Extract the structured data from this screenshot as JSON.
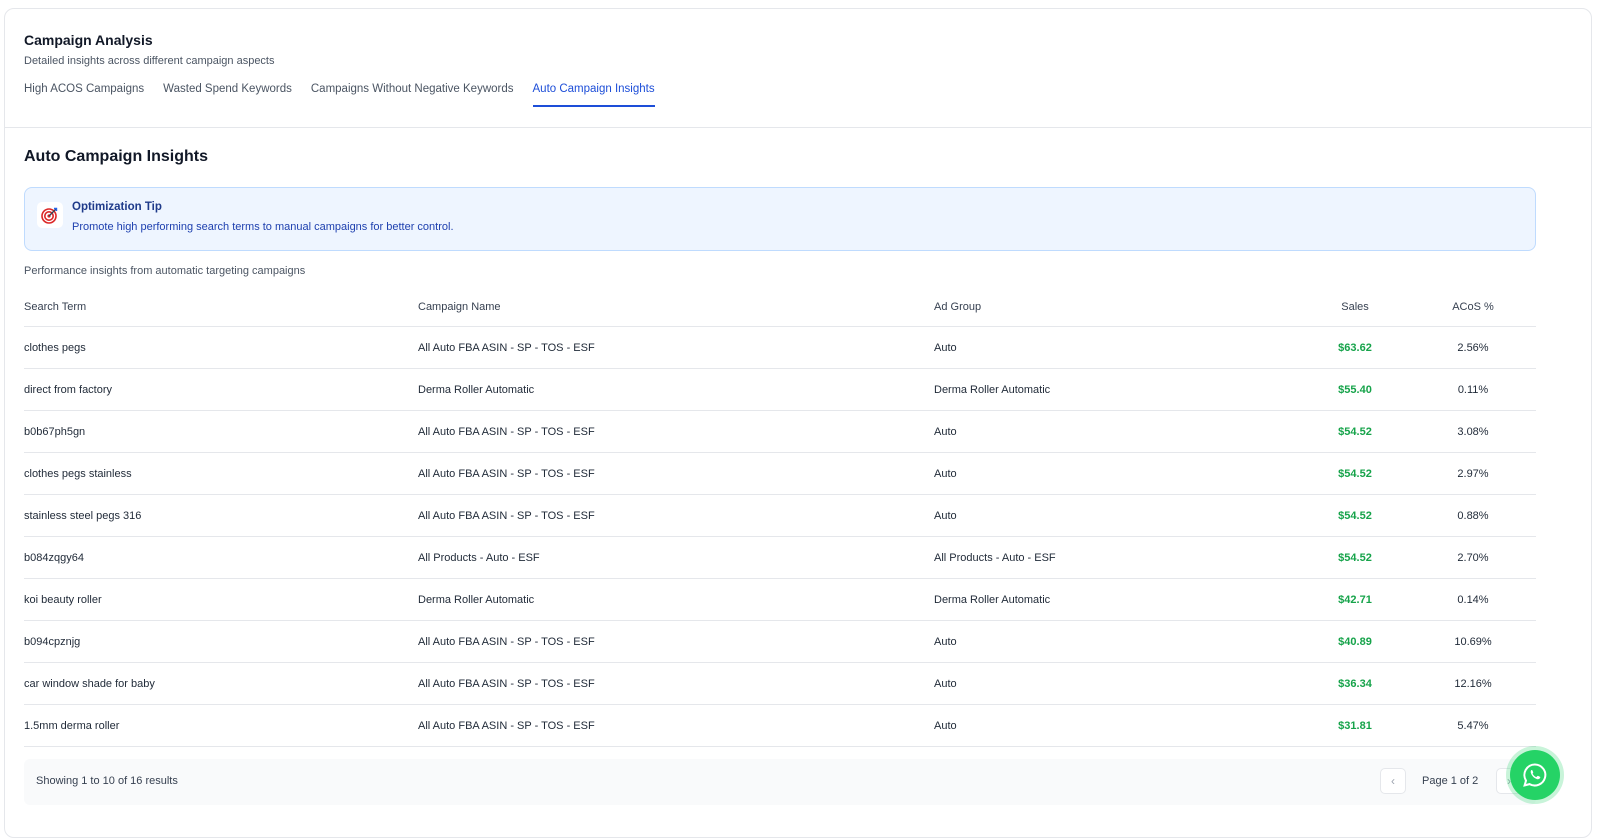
{
  "header": {
    "title": "Campaign Analysis",
    "subtitle": "Detailed insights across different campaign aspects",
    "tabs": [
      {
        "label": "High ACOS Campaigns"
      },
      {
        "label": "Wasted Spend Keywords"
      },
      {
        "label": "Campaigns Without Negative Keywords"
      },
      {
        "label": "Auto Campaign Insights"
      }
    ],
    "active_tab": "Auto Campaign Insights"
  },
  "section": {
    "title": "Auto Campaign Insights",
    "tip_title": "Optimization Tip",
    "tip_text": "Promote high performing search terms to manual campaigns for better control.",
    "note": "Performance insights from automatic targeting campaigns"
  },
  "table": {
    "columns": [
      "Search Term",
      "Campaign Name",
      "Ad Group",
      "Sales",
      "ACoS %"
    ],
    "rows": [
      [
        "clothes pegs",
        "All Auto FBA ASIN - SP - TOS - ESF",
        "Auto",
        "$63.62",
        "2.56%"
      ],
      [
        "direct from factory",
        "Derma Roller Automatic",
        "Derma Roller Automatic",
        "$55.40",
        "0.11%"
      ],
      [
        "b0b67ph5gn",
        "All Auto FBA ASIN - SP - TOS - ESF",
        "Auto",
        "$54.52",
        "3.08%"
      ],
      [
        "clothes pegs stainless",
        "All Auto FBA ASIN - SP - TOS - ESF",
        "Auto",
        "$54.52",
        "2.97%"
      ],
      [
        "stainless steel pegs 316",
        "All Auto FBA ASIN - SP - TOS - ESF",
        "Auto",
        "$54.52",
        "0.88%"
      ],
      [
        "b084zqgy64",
        "All Products - Auto - ESF",
        "All Products - Auto - ESF",
        "$54.52",
        "2.70%"
      ],
      [
        "koi beauty roller",
        "Derma Roller Automatic",
        "Derma Roller Automatic",
        "$42.71",
        "0.14%"
      ],
      [
        "b094cpznjg",
        "All Auto FBA ASIN - SP - TOS - ESF",
        "Auto",
        "$40.89",
        "10.69%"
      ],
      [
        "car window shade for baby",
        "All Auto FBA ASIN - SP - TOS - ESF",
        "Auto",
        "$36.34",
        "12.16%"
      ],
      [
        "1.5mm derma roller",
        "All Auto FBA ASIN - SP - TOS - ESF",
        "Auto",
        "$31.81",
        "5.47%"
      ]
    ]
  },
  "pagination": {
    "showing": "Showing 1 to 10 of 16 results",
    "page_label": "Page 1 of 2",
    "prev_glyph": "‹",
    "next_glyph": "›"
  },
  "colors": {
    "accent": "#1d4ed8",
    "sales_green": "#16a34a",
    "tip_bg": "#eef5ff",
    "whatsapp": "#25d366"
  },
  "icons": {
    "tip": "target-icon",
    "chat": "whatsapp-icon"
  }
}
